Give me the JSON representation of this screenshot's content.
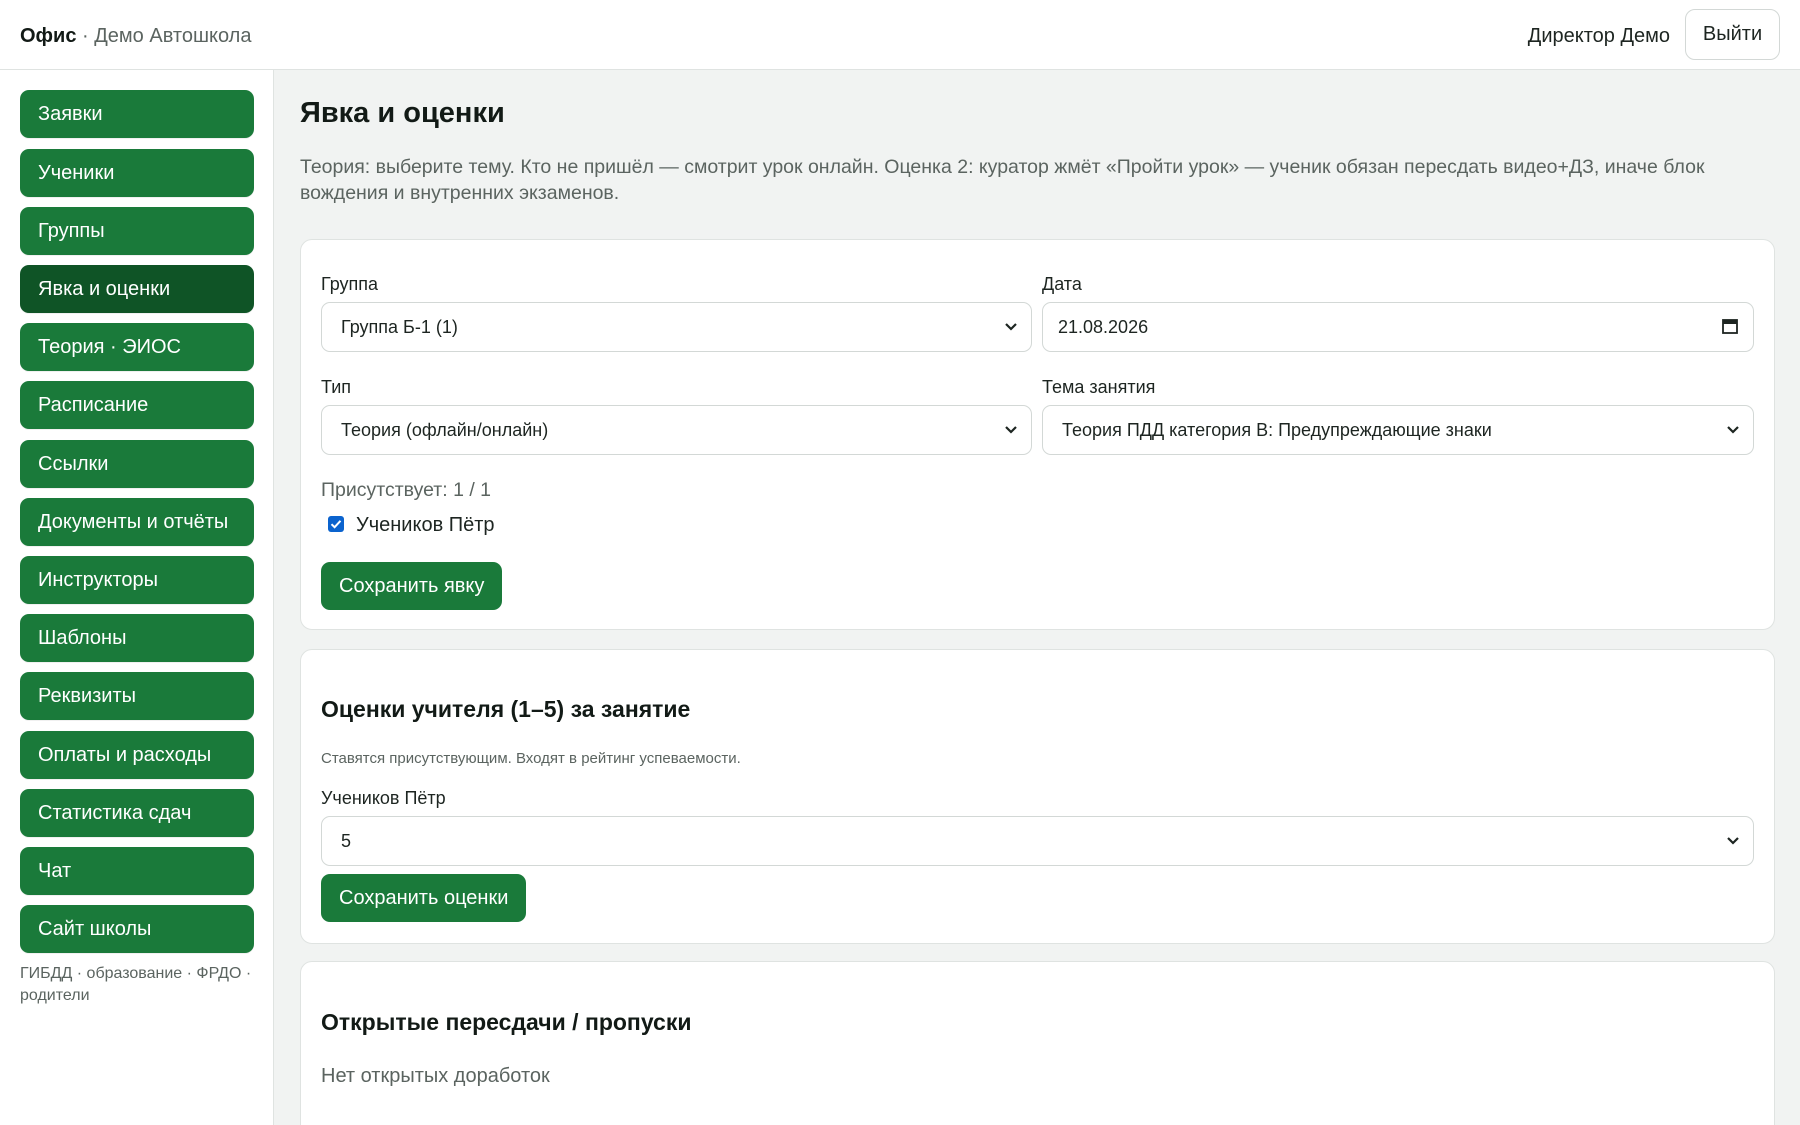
{
  "header": {
    "brand": "Офис",
    "brand_separator": " · ",
    "school": "Демо Автошкола",
    "user": "Директор Демо",
    "logout": "Выйти"
  },
  "sidebar": {
    "items": [
      {
        "label": "Заявки",
        "active": false
      },
      {
        "label": "Ученики",
        "active": false
      },
      {
        "label": "Группы",
        "active": false
      },
      {
        "label": "Явка и оценки",
        "active": true
      },
      {
        "label": "Теория · ЭИОС",
        "active": false
      },
      {
        "label": "Расписание",
        "active": false
      },
      {
        "label": "Ссылки",
        "active": false
      },
      {
        "label": "Документы и отчёты",
        "active": false
      },
      {
        "label": "Инструкторы",
        "active": false
      },
      {
        "label": "Шаблоны",
        "active": false
      },
      {
        "label": "Реквизиты",
        "active": false
      },
      {
        "label": "Оплаты и расходы",
        "active": false
      },
      {
        "label": "Статистика сдач",
        "active": false
      },
      {
        "label": "Чат",
        "active": false
      },
      {
        "label": "Сайт школы",
        "active": false
      }
    ],
    "footer": "ГИБДД · образование · ФРДО · родители"
  },
  "page": {
    "title": "Явка и оценки",
    "description": "Теория: выберите тему. Кто не пришёл — смотрит урок онлайн. Оценка 2: куратор жмёт «Пройти урок» — ученик обязан пересдать видео+ДЗ, иначе блок вождения и внутренних экзаменов."
  },
  "attendance": {
    "group_label": "Группа",
    "group_value": "Группа Б-1 (1)",
    "date_label": "Дата",
    "date_value": "21.08.2026",
    "type_label": "Тип",
    "type_value": "Теория (офлайн/онлайн)",
    "topic_label": "Тема занятия",
    "topic_value": "Теория ПДД категория B: Предупреждающие знаки",
    "present_count": "Присутствует: 1 / 1",
    "student_name": "Учеников Пётр",
    "student_checked": true,
    "save_button": "Сохранить явку"
  },
  "grades": {
    "title": "Оценки учителя (1–5) за занятие",
    "note": "Ставятся присутствующим. Входят в рейтинг успеваемости.",
    "student_name": "Учеников Пётр",
    "grade_value": "5",
    "save_button": "Сохранить оценки"
  },
  "retakes": {
    "title": "Открытые пересдачи / пропуски",
    "empty": "Нет открытых доработок"
  },
  "colors": {
    "accent": "#1a7a3a",
    "accent_active": "#0f5426",
    "checkbox": "#0b63ce"
  }
}
